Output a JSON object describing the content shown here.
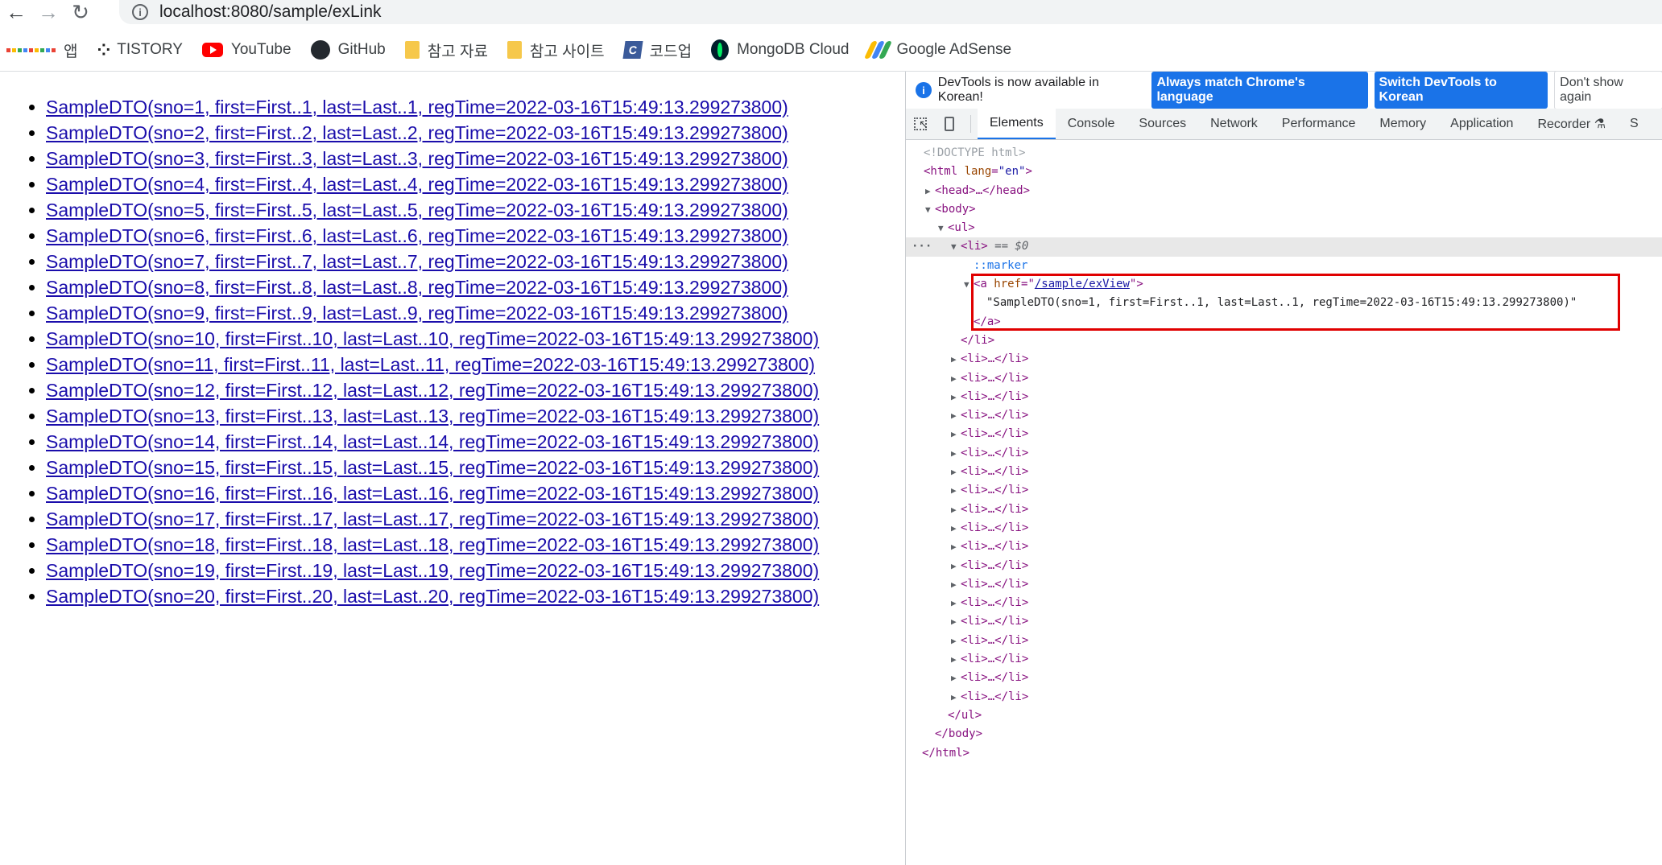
{
  "browser": {
    "url": "localhost:8080/sample/exLink",
    "bookmarks": [
      {
        "label": "앱",
        "icon": "apps-grid-icon"
      },
      {
        "label": "TISTORY",
        "icon": "tistory-icon"
      },
      {
        "label": "YouTube",
        "icon": "youtube-icon"
      },
      {
        "label": "GitHub",
        "icon": "github-icon"
      },
      {
        "label": "참고 자료",
        "icon": "folder-icon"
      },
      {
        "label": "참고 사이트",
        "icon": "folder-icon"
      },
      {
        "label": "코드업",
        "icon": "codeup-icon"
      },
      {
        "label": "MongoDB Cloud",
        "icon": "mongodb-icon"
      },
      {
        "label": "Google AdSense",
        "icon": "adsense-icon"
      }
    ]
  },
  "page": {
    "links": [
      "SampleDTO(sno=1, first=First..1, last=Last..1, regTime=2022-03-16T15:49:13.299273800)",
      "SampleDTO(sno=2, first=First..2, last=Last..2, regTime=2022-03-16T15:49:13.299273800)",
      "SampleDTO(sno=3, first=First..3, last=Last..3, regTime=2022-03-16T15:49:13.299273800)",
      "SampleDTO(sno=4, first=First..4, last=Last..4, regTime=2022-03-16T15:49:13.299273800)",
      "SampleDTO(sno=5, first=First..5, last=Last..5, regTime=2022-03-16T15:49:13.299273800)",
      "SampleDTO(sno=6, first=First..6, last=Last..6, regTime=2022-03-16T15:49:13.299273800)",
      "SampleDTO(sno=7, first=First..7, last=Last..7, regTime=2022-03-16T15:49:13.299273800)",
      "SampleDTO(sno=8, first=First..8, last=Last..8, regTime=2022-03-16T15:49:13.299273800)",
      "SampleDTO(sno=9, first=First..9, last=Last..9, regTime=2022-03-16T15:49:13.299273800)",
      "SampleDTO(sno=10, first=First..10, last=Last..10, regTime=2022-03-16T15:49:13.299273800)",
      "SampleDTO(sno=11, first=First..11, last=Last..11, regTime=2022-03-16T15:49:13.299273800)",
      "SampleDTO(sno=12, first=First..12, last=Last..12, regTime=2022-03-16T15:49:13.299273800)",
      "SampleDTO(sno=13, first=First..13, last=Last..13, regTime=2022-03-16T15:49:13.299273800)",
      "SampleDTO(sno=14, first=First..14, last=Last..14, regTime=2022-03-16T15:49:13.299273800)",
      "SampleDTO(sno=15, first=First..15, last=Last..15, regTime=2022-03-16T15:49:13.299273800)",
      "SampleDTO(sno=16, first=First..16, last=Last..16, regTime=2022-03-16T15:49:13.299273800)",
      "SampleDTO(sno=17, first=First..17, last=Last..17, regTime=2022-03-16T15:49:13.299273800)",
      "SampleDTO(sno=18, first=First..18, last=Last..18, regTime=2022-03-16T15:49:13.299273800)",
      "SampleDTO(sno=19, first=First..19, last=Last..19, regTime=2022-03-16T15:49:13.299273800)",
      "SampleDTO(sno=20, first=First..20, last=Last..20, regTime=2022-03-16T15:49:13.299273800)"
    ]
  },
  "devtools": {
    "banner_text": "DevTools is now available in Korean!",
    "btn_match": "Always match Chrome's language",
    "btn_switch": "Switch DevTools to Korean",
    "btn_dismiss": "Don't show again",
    "tabs": [
      "Elements",
      "Console",
      "Sources",
      "Network",
      "Performance",
      "Memory",
      "Application",
      "Recorder ⚗",
      "S"
    ],
    "active_tab": "Elements",
    "doctype": "<!DOCTYPE html>",
    "html_open": "<html ",
    "html_lang_attr": "lang",
    "html_lang_val": "\"en\"",
    "head_collapsed": "<head>…</head>",
    "body_open": "<body>",
    "ul_open": "<ul>",
    "li_open": "<li>",
    "selected_marker": " == $0",
    "marker": "::marker",
    "a_open": "<a ",
    "a_href_attr": "href",
    "a_href_val": "/sample/exView",
    "a_text": "\"SampleDTO(sno=1, first=First..1, last=Last..1, regTime=2022-03-16T15:49:13.299273800)\"",
    "a_close": "</a>",
    "li_close": "</li>",
    "li_collapsed": "<li>…</li>",
    "collapsed_count": 19,
    "ul_close": "</ul>",
    "body_close": "</body>",
    "html_close": "</html>",
    "accent_color": "#1a73e8",
    "highlight_color": "#e00000"
  }
}
